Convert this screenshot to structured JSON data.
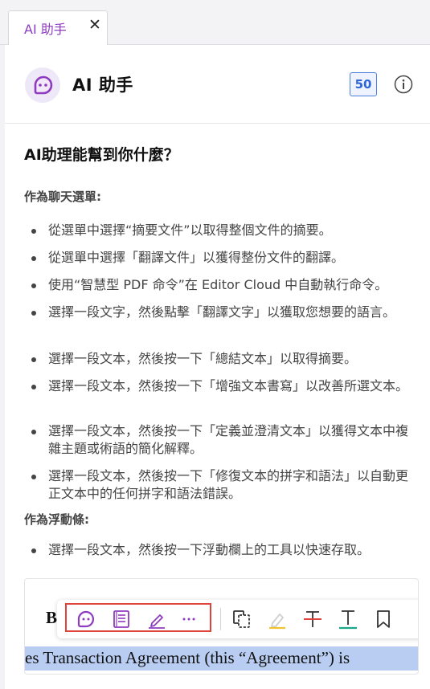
{
  "tab": {
    "label": "AI 助手",
    "close_symbol": "✕"
  },
  "header": {
    "title": "AI 助手",
    "credits": "50"
  },
  "intro": {
    "question": "AI助理能幫到你什麼？"
  },
  "sections": [
    {
      "heading": "作為聊天選單:",
      "items": [
        "從選單中選擇“摘要文件”以取得整個文件的摘要。",
        "從選單中選擇「翻譯文件」以獲得整份文件的翻譯。",
        "使用“智慧型 PDF 命令”在 Editor Cloud 中自動執行命令。",
        "選擇一段文字，然後點擊「翻譯文字」以獲取您想要的語言。",
        "選擇一段文本，然後按一下「總結文本」以取得摘要。",
        "選擇一段文本，然後按一下「增強文本書寫」以改善所選文本。",
        "選擇一段文本，然後按一下「定義並澄清文本」以獲得文本中複雜主題或術語的簡化解釋。",
        "選擇一段文本，然後按一下「修復文本的拼字和語法」以自動更正文本中的任何拼字和語法錯誤。"
      ]
    },
    {
      "heading": "作為浮動條:",
      "items": [
        "選擇一段文本，然後按一下浮動欄上的工具以快速存取。"
      ]
    }
  ],
  "preview": {
    "bold_letter": "B",
    "document_text": "es Transaction Agreement (this “Agreement”) is",
    "toolbar_icons": [
      "ai-assistant-icon",
      "summary-icon",
      "rewrite-pen-icon",
      "more-icon",
      "copy-icon",
      "highlight-icon",
      "strikethrough-icon",
      "underline-icon",
      "bookmark-icon"
    ]
  },
  "colors": {
    "accent_purple": "#8e3bbf",
    "credit_blue": "#2f66d8",
    "highlight_box_red": "#e0433a",
    "selection_blue": "#b9cdf2"
  }
}
